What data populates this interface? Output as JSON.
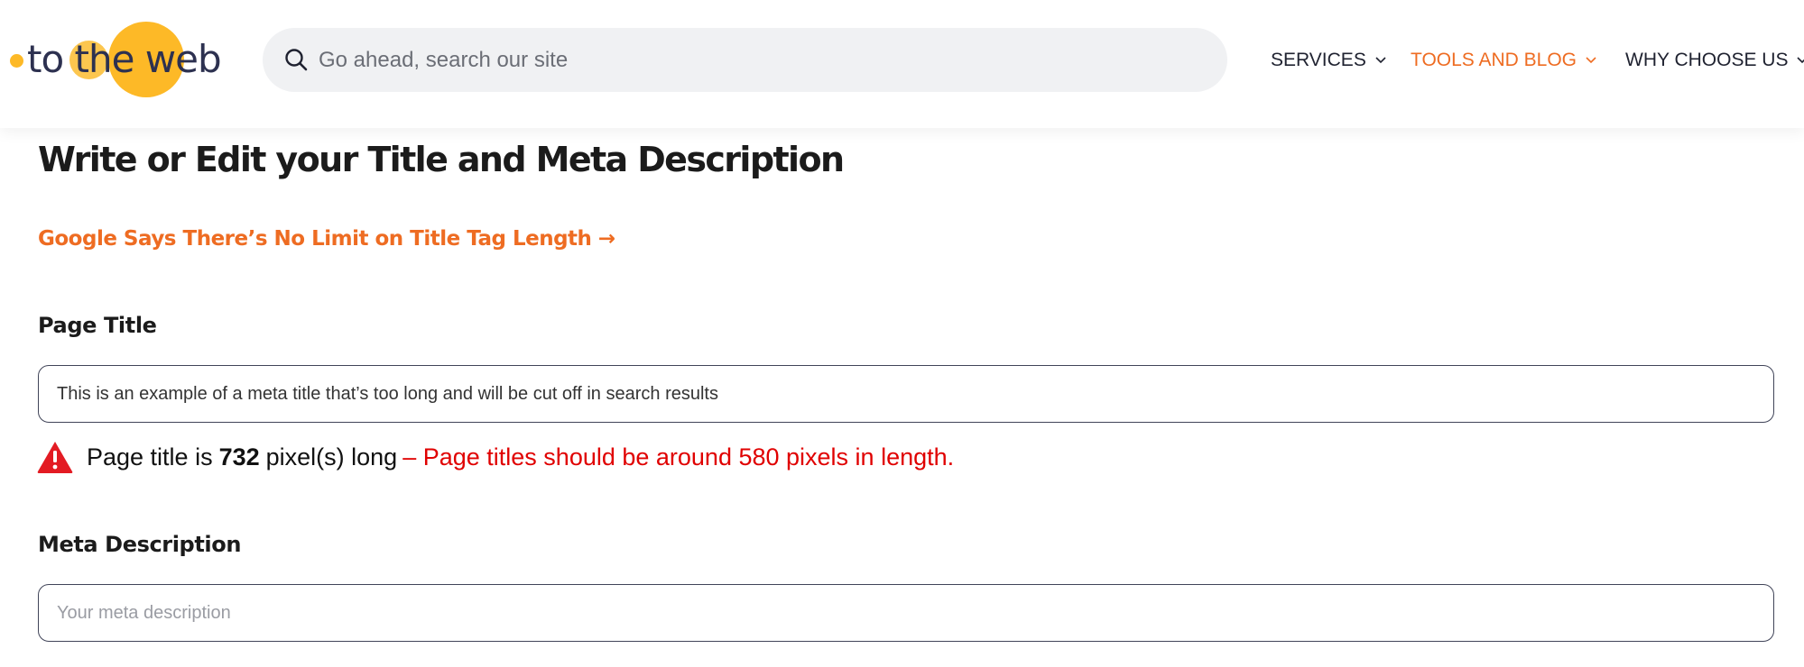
{
  "colors": {
    "brand_yellow": "#fdb927",
    "brand_navy": "#2d3150",
    "accent_orange": "#ee6c22",
    "error_red": "#e00000",
    "search_bg": "#f0f1f3",
    "nav_text": "#1f2230"
  },
  "logo": {
    "text": "to the web"
  },
  "search": {
    "placeholder": "Go ahead, search our site",
    "icon": "search-icon"
  },
  "nav": {
    "items": [
      {
        "label": "SERVICES",
        "active": false,
        "icon": "chevron-down-icon"
      },
      {
        "label": "TOOLS AND BLOG",
        "active": true,
        "icon": "chevron-down-icon"
      },
      {
        "label": "WHY CHOOSE US",
        "active": false,
        "icon": "chevron-down-icon"
      }
    ]
  },
  "main": {
    "heading": "Write or Edit your Title and Meta Description",
    "link": "Google Says There’s No Limit on Title Tag Length →",
    "page_title": {
      "label": "Page Title",
      "value": "This is an example of a meta title that’s too long and will be cut off in search results",
      "warning": {
        "icon": "warning-triangle-icon",
        "prefix": "Page title is",
        "pixel_count": "732",
        "suffix": "pixel(s) long",
        "error": "– Page titles should be around 580 pixels in length."
      }
    },
    "meta_description": {
      "label": "Meta Description",
      "value": "",
      "placeholder": "Your meta description"
    }
  }
}
